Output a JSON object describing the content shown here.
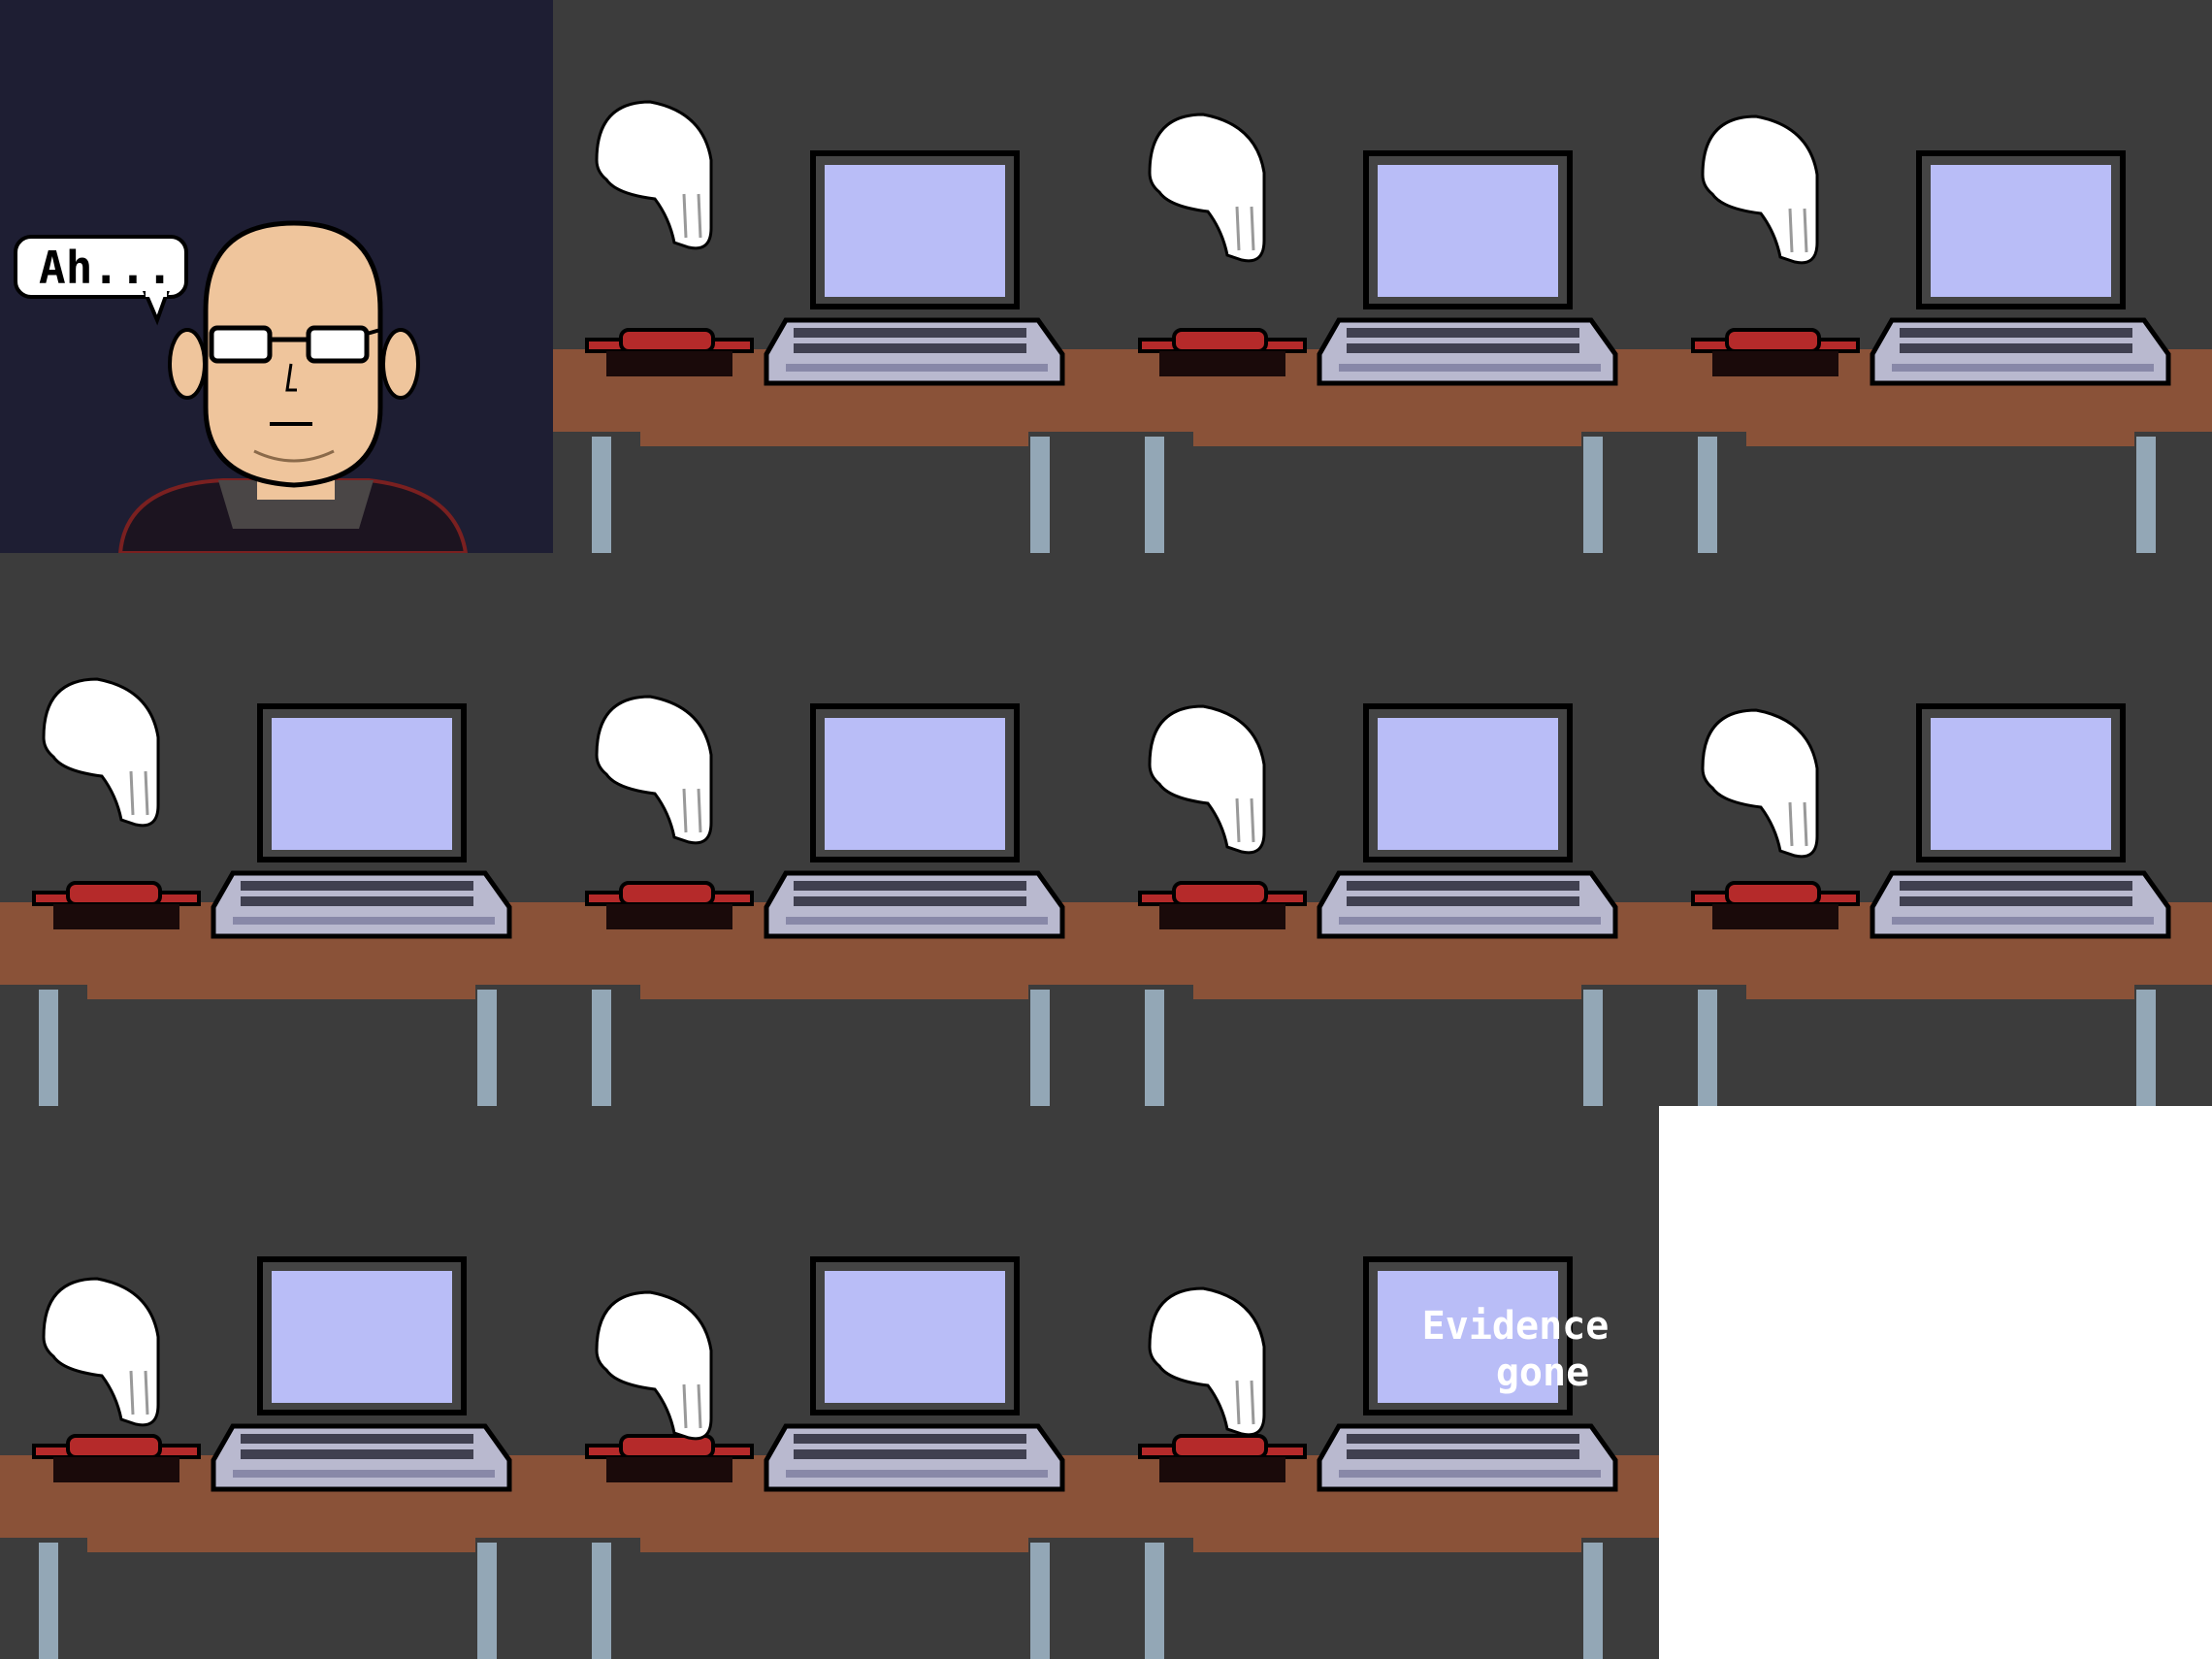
{
  "comic": {
    "intro_panel": {
      "speech_bubble": "Ah..."
    },
    "final_screen_text": {
      "line1": "Evidence",
      "line2": "gone"
    }
  },
  "colors": {
    "background": "#3c3c3c",
    "intro_background": "#1e1e33",
    "desk": "#8a5238",
    "desk_leg": "#93a7b6",
    "screen": "#b9bdf7",
    "laptop_body": "#b9b9cf",
    "button_red": "#b52a2a",
    "button_base": "#1a0a0a",
    "skin": "#efc59c",
    "hand": "#ffffff"
  },
  "icons": [
    "speech-bubble-icon",
    "laptop-icon",
    "red-button-icon",
    "pointing-hand-icon"
  ]
}
